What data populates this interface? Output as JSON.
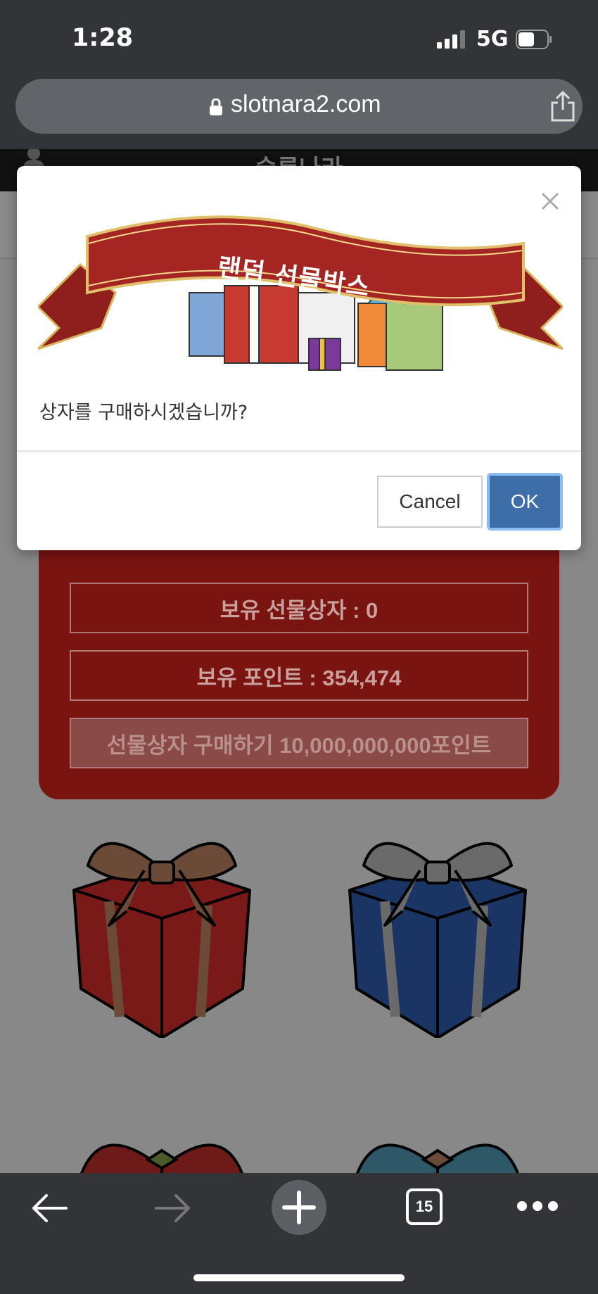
{
  "status_bar": {
    "time": "1:28",
    "network": "5G"
  },
  "browser": {
    "url": "slotnara2.com",
    "tab_count": "15"
  },
  "site": {
    "title": "슬롯나라"
  },
  "panel": {
    "owned_boxes": "보유 선물상자 : 0",
    "owned_points": "보유 포인트 : 354,474",
    "buy_button": "선물상자 구매하기 10,000,000,000포인트"
  },
  "modal": {
    "banner_title": "랜덤 선물박스",
    "message": "상자를 구매하시겠습니까?",
    "cancel_label": "Cancel",
    "ok_label": "OK"
  },
  "colors": {
    "ok_button": "#3d6ea8",
    "panel": "#7a1411",
    "gift_red": "#7a1a18",
    "gift_blue": "#1a3564"
  },
  "icons": [
    "lock-icon",
    "share-icon",
    "close-icon",
    "back-arrow-icon",
    "forward-arrow-icon",
    "new-tab-icon",
    "tabs-icon",
    "more-icon"
  ]
}
